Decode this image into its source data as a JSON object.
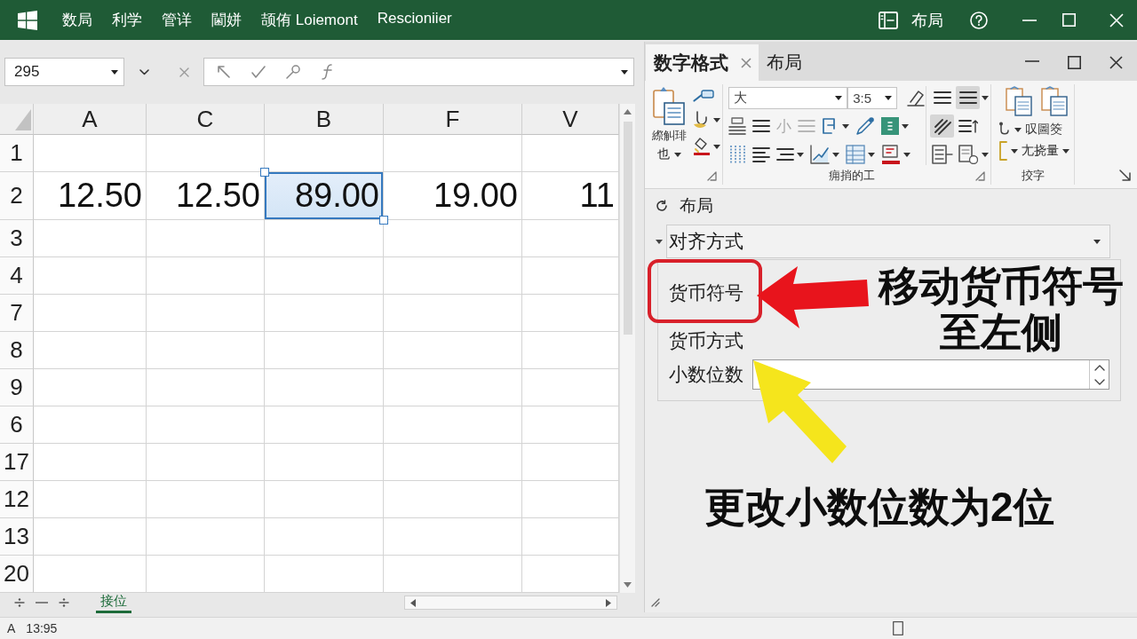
{
  "title_bar": {
    "menu": [
      "数局",
      "利学",
      "管详",
      "閫姘",
      "颉侑 Loiemont",
      "Rescioniier"
    ],
    "layout_label": "布局"
  },
  "formula_bar": {
    "name_box": "295"
  },
  "sheet": {
    "columns": [
      "A",
      "C",
      "B",
      "F",
      "V"
    ],
    "rows": [
      {
        "label": "1"
      },
      {
        "label": "2",
        "cells": [
          {
            "value": "12.50",
            "selected": false
          },
          {
            "value": "12.50",
            "selected": false
          },
          {
            "value": "89.00",
            "selected": true
          },
          {
            "value": "19.00",
            "selected": false
          },
          {
            "value": "11",
            "selected": false
          }
        ]
      },
      {
        "label": "3"
      },
      {
        "label": "4"
      },
      {
        "label": "7"
      },
      {
        "label": "8"
      },
      {
        "label": "9"
      },
      {
        "label": "6"
      },
      {
        "label": "17"
      },
      {
        "label": "12"
      },
      {
        "label": "13"
      },
      {
        "label": "20"
      }
    ],
    "tabs": [
      {
        "label": "接位",
        "selected": true
      }
    ]
  },
  "panel": {
    "tabs": [
      {
        "label": "数字格式",
        "selected": true,
        "closable": true
      },
      {
        "label": "布局",
        "selected": false,
        "closable": false
      }
    ],
    "ribbon": {
      "paste_label": "縩觓琲",
      "paste_menu": "也",
      "font_name": "大",
      "font_size": "3:5",
      "glyph_tool": {
        "label": "小",
        "disabled": true
      },
      "font_group_label": "痈捎的工",
      "align_tools": [
        {
          "pressed": false
        },
        {
          "pressed": true
        },
        {
          "pressed": true
        },
        {
          "pressed": false
        },
        {
          "pressed": false
        },
        {
          "pressed": false
        }
      ],
      "commands": [
        "叹圖筊",
        "尢挠量"
      ],
      "command_group_label": "挍字"
    },
    "section_title": "布局",
    "dropdown": {
      "value": "对齐方式"
    },
    "fields": [
      {
        "kind": "label",
        "label": "货币符号",
        "highlighted": true
      },
      {
        "kind": "label",
        "label": "货币方式",
        "highlighted": false
      },
      {
        "kind": "number",
        "label": "小数位数",
        "highlighted": false
      }
    ]
  },
  "callouts": [
    {
      "text": "移动货币符号至左侧",
      "color": "#e8141c"
    },
    {
      "text": "更改小数位数为2位",
      "color": "#f5e51c"
    }
  ],
  "status_bar": {
    "items": [
      "A",
      "13:95"
    ]
  }
}
